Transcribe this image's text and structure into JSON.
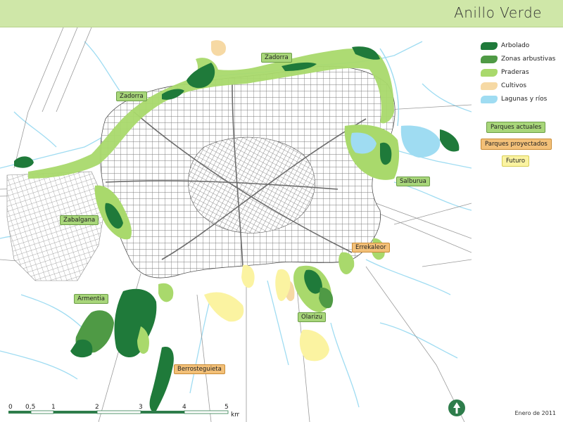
{
  "header": {
    "title": "Anillo Verde"
  },
  "legend": {
    "items": [
      {
        "label": "Arbolado",
        "color": "#1f7a3a"
      },
      {
        "label": "Zonas arbustivas",
        "color": "#4f9a45"
      },
      {
        "label": "Praderas",
        "color": "#a9d96c"
      },
      {
        "label": "Cultivos",
        "color": "#f6d9a4"
      },
      {
        "label": "Lagunas y ríos",
        "color": "#9fdcf2"
      }
    ],
    "badges": [
      {
        "label": "Parques actuales",
        "kind": "actual"
      },
      {
        "label": "Parques proyectados",
        "kind": "proj"
      },
      {
        "label": "Futuro",
        "kind": "future"
      }
    ]
  },
  "map": {
    "labels": [
      {
        "id": "zadorra-north",
        "text": "Zadorra",
        "kind": "actual"
      },
      {
        "id": "zadorra-west",
        "text": "Zadorra",
        "kind": "actual"
      },
      {
        "id": "salburua",
        "text": "Salburua",
        "kind": "actual"
      },
      {
        "id": "zabalgana",
        "text": "Zabalgana",
        "kind": "actual"
      },
      {
        "id": "errekaleor",
        "text": "Errekaleor",
        "kind": "proj"
      },
      {
        "id": "armentia",
        "text": "Armentia",
        "kind": "actual"
      },
      {
        "id": "olarizu",
        "text": "Olarizu",
        "kind": "actual"
      },
      {
        "id": "berrostegieta",
        "text": "Berrosteguieta",
        "kind": "proj"
      }
    ]
  },
  "scale": {
    "ticks": [
      "0",
      "0,5",
      "1",
      "2",
      "3",
      "4",
      "5"
    ],
    "unit": "km"
  },
  "footer": {
    "date": "Enero de 2011"
  }
}
